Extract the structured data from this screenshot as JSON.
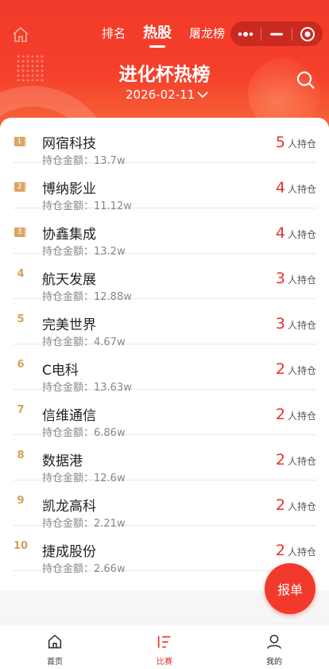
{
  "header": {
    "tabs": [
      {
        "label": "排名",
        "active": false
      },
      {
        "label": "热股",
        "active": true
      },
      {
        "label": "屠龙榜",
        "active": false
      }
    ],
    "title": "进化杯热榜",
    "date": "2026-02-11",
    "accent_color": "#f23a2a",
    "icons": [
      "home-icon",
      "more-icon",
      "minimize-icon",
      "close-target-icon",
      "search-icon",
      "chevron-down-icon"
    ]
  },
  "list": {
    "amount_prefix": "持仓金额：",
    "holders_unit": "人持仓",
    "items": [
      {
        "rank": "1",
        "name": "网宿科技",
        "amount": "持仓金额：13.7w",
        "holders": "5"
      },
      {
        "rank": "2",
        "name": "博纳影业",
        "amount": "持仓金额：11.12w",
        "holders": "4"
      },
      {
        "rank": "3",
        "name": "协鑫集成",
        "amount": "持仓金额：13.2w",
        "holders": "4"
      },
      {
        "rank": "4",
        "name": "航天发展",
        "amount": "持仓金额：12.88w",
        "holders": "3"
      },
      {
        "rank": "5",
        "name": "完美世界",
        "amount": "持仓金额：4.67w",
        "holders": "3"
      },
      {
        "rank": "6",
        "name": "C电科",
        "amount": "持仓金额：13.63w",
        "holders": "2"
      },
      {
        "rank": "7",
        "name": "信维通信",
        "amount": "持仓金额：6.86w",
        "holders": "2"
      },
      {
        "rank": "8",
        "name": "数据港",
        "amount": "持仓金额：12.6w",
        "holders": "2"
      },
      {
        "rank": "9",
        "name": "凯龙高科",
        "amount": "持仓金额：2.21w",
        "holders": "2"
      },
      {
        "rank": "10",
        "name": "捷成股份",
        "amount": "持仓金额：2.66w",
        "holders": "2"
      }
    ]
  },
  "fab": {
    "label": "报单"
  },
  "bottom_nav": [
    {
      "label": "首页",
      "icon": "home-icon",
      "active": false
    },
    {
      "label": "比赛",
      "icon": "list-icon",
      "active": true
    },
    {
      "label": "我的",
      "icon": "user-icon",
      "active": false
    }
  ],
  "colors": {
    "red": "#e5322d",
    "gold": "#d4a15a",
    "text": "#222222",
    "muted": "#888888"
  }
}
